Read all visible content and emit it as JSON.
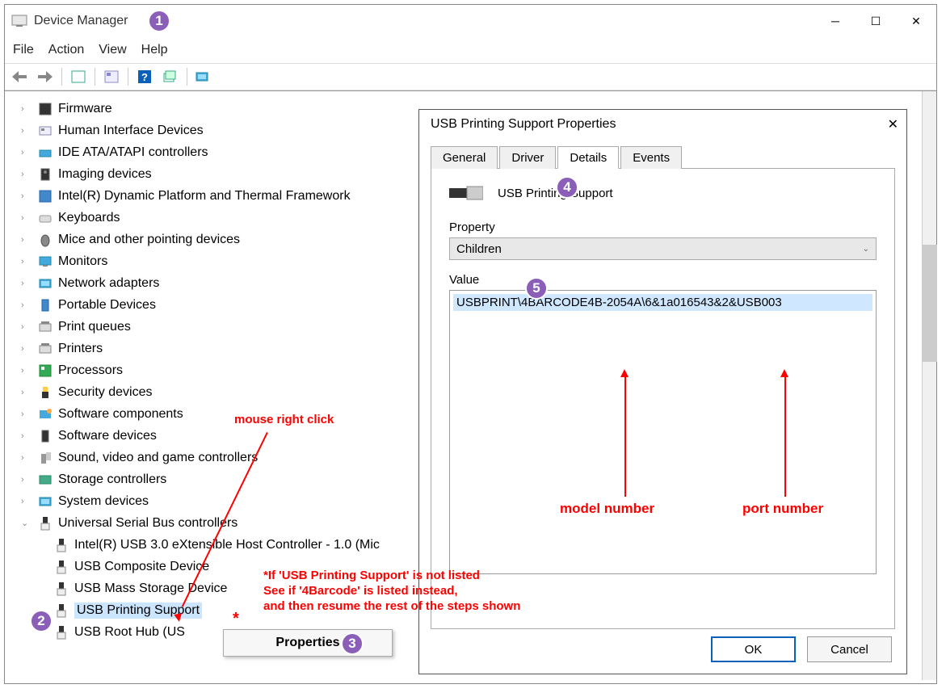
{
  "window": {
    "title": "Device Manager"
  },
  "menu": {
    "file": "File",
    "action": "Action",
    "view": "View",
    "help": "Help"
  },
  "tree": {
    "items": [
      "Firmware",
      "Human Interface Devices",
      "IDE ATA/ATAPI controllers",
      "Imaging devices",
      "Intel(R) Dynamic Platform and Thermal Framework",
      "Keyboards",
      "Mice and other pointing devices",
      "Monitors",
      "Network adapters",
      "Portable Devices",
      "Print queues",
      "Printers",
      "Processors",
      "Security devices",
      "Software components",
      "Software devices",
      "Sound, video and game controllers",
      "Storage controllers",
      "System devices"
    ],
    "usb_parent": "Universal Serial Bus controllers",
    "usb_children": [
      "Intel(R) USB 3.0 eXtensible Host Controller - 1.0 (Mic",
      "USB Composite Device",
      "USB Mass Storage Device",
      "USB Printing Support",
      "USB Root Hub (US"
    ]
  },
  "ctx": {
    "properties": "Properties"
  },
  "dialog": {
    "title": "USB Printing Support Properties",
    "tabs": {
      "general": "General",
      "driver": "Driver",
      "details": "Details",
      "events": "Events"
    },
    "device_name": "USB Printing Support",
    "property_label": "Property",
    "property_selected": "Children",
    "value_label": "Value",
    "value_row": "USBPRINT\\4BARCODE4B-2054A\\6&1a016543&2&USB003",
    "ok": "OK",
    "cancel": "Cancel"
  },
  "annotations": {
    "c1": "1",
    "c2": "2",
    "c3": "3",
    "c4": "4",
    "c5": "5",
    "right_click": "mouse right click",
    "note_l1": "*If 'USB Printing Support' is not listed",
    "note_l2": "See if '4Barcode' is listed instead,",
    "note_l3": "and then resume the rest of the steps shown",
    "model": "model number",
    "port": "port number",
    "asterisk": "*"
  }
}
